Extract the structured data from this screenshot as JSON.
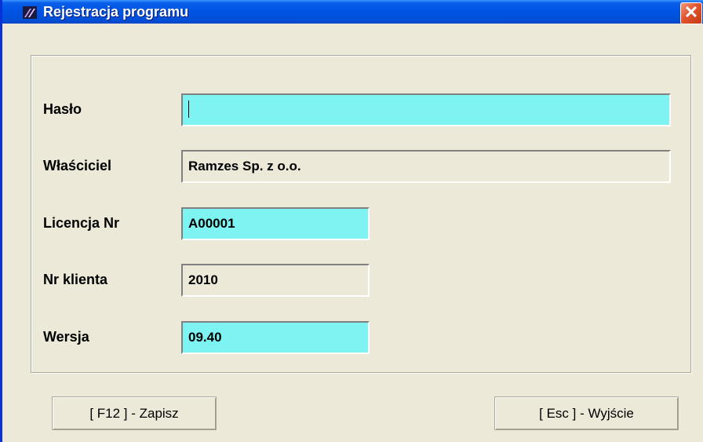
{
  "window": {
    "title": "Rejestracja programu",
    "close_symbol": "✕",
    "app_icon": "app-logo-icon"
  },
  "form": {
    "password": {
      "label": "Hasło",
      "value": ""
    },
    "owner": {
      "label": "Właściciel",
      "value": "Ramzes Sp. z o.o."
    },
    "license": {
      "label": "Licencja Nr",
      "value": "A00001"
    },
    "client": {
      "label": "Nr klienta",
      "value": "2010"
    },
    "version": {
      "label": "Wersja",
      "value": "09.40"
    }
  },
  "buttons": {
    "save": "[ F12 ] - Zapisz",
    "exit": "[ Esc ] - Wyjście"
  },
  "colors": {
    "editable_field": "#7EF4F2",
    "readonly_field": "#ECE9D8",
    "title_bar": "#0054E3",
    "window_bg": "#ECE9D8"
  }
}
